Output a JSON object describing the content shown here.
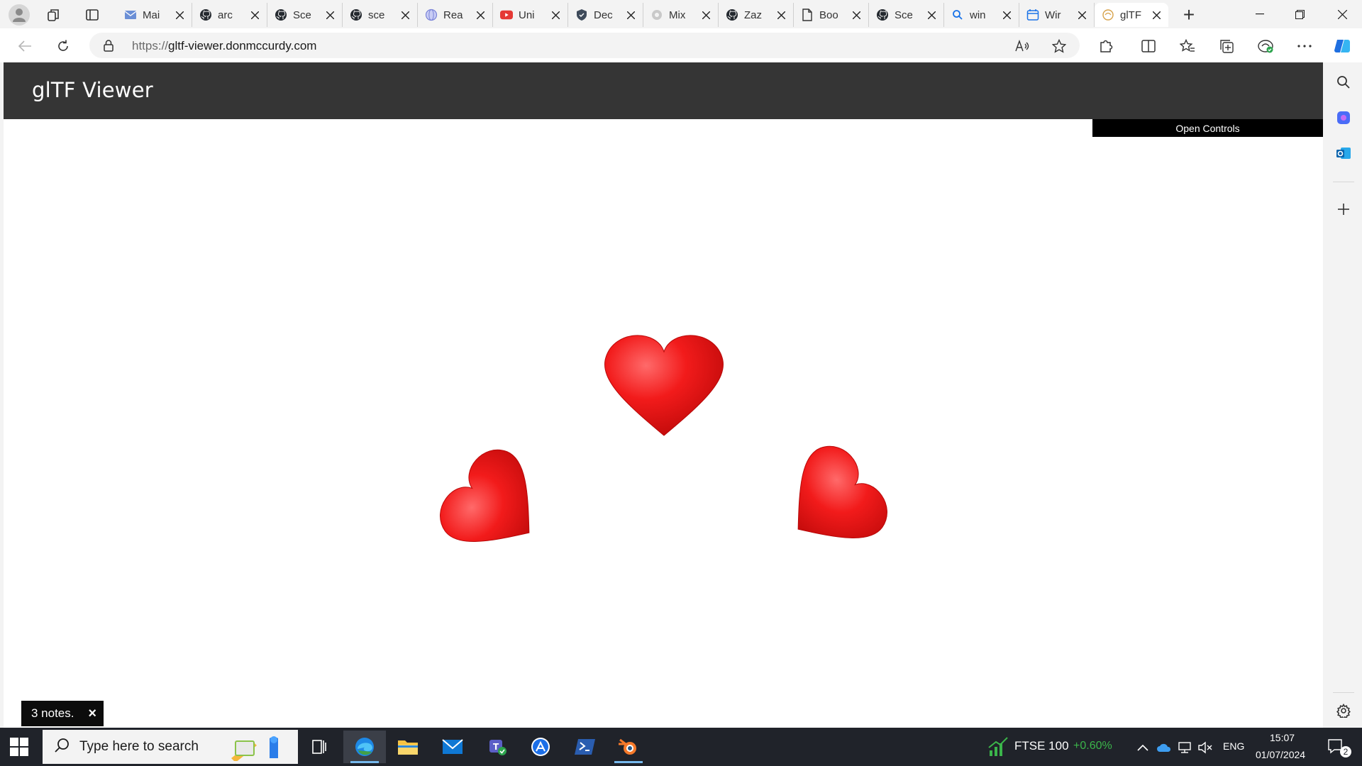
{
  "browser": {
    "tabs": [
      {
        "title": "Mai",
        "icon": "mail-icon"
      },
      {
        "title": "arc",
        "icon": "github-icon"
      },
      {
        "title": "Sce",
        "icon": "github-icon"
      },
      {
        "title": "sce",
        "icon": "github-icon"
      },
      {
        "title": "Rea",
        "icon": "globe-icon"
      },
      {
        "title": "Uni",
        "icon": "youtube-icon"
      },
      {
        "title": "Dec",
        "icon": "shield-icon"
      },
      {
        "title": "Mix",
        "icon": "gear-icon"
      },
      {
        "title": "Zaz",
        "icon": "github-icon"
      },
      {
        "title": "Boo",
        "icon": "document-icon"
      },
      {
        "title": "Sce",
        "icon": "github-icon"
      },
      {
        "title": "win",
        "icon": "search-icon"
      },
      {
        "title": "Wir",
        "icon": "calendar-icon"
      },
      {
        "title": "glTF",
        "icon": "gltf-icon",
        "active": true
      }
    ],
    "url_protocol": "https://",
    "url_host": "gltf-viewer.donmccurdy.com"
  },
  "page": {
    "title": "glTF Viewer",
    "open_controls_label": "Open Controls",
    "toast_text": "3 notes.",
    "toast_close": "×",
    "model_color": "#f21b1b"
  },
  "taskbar": {
    "search_placeholder": "Type here to search",
    "ticker_name": "FTSE 100",
    "ticker_change": "+0.60%",
    "language": "ENG",
    "time": "15:07",
    "date": "01/07/2024",
    "notification_count": "2"
  }
}
